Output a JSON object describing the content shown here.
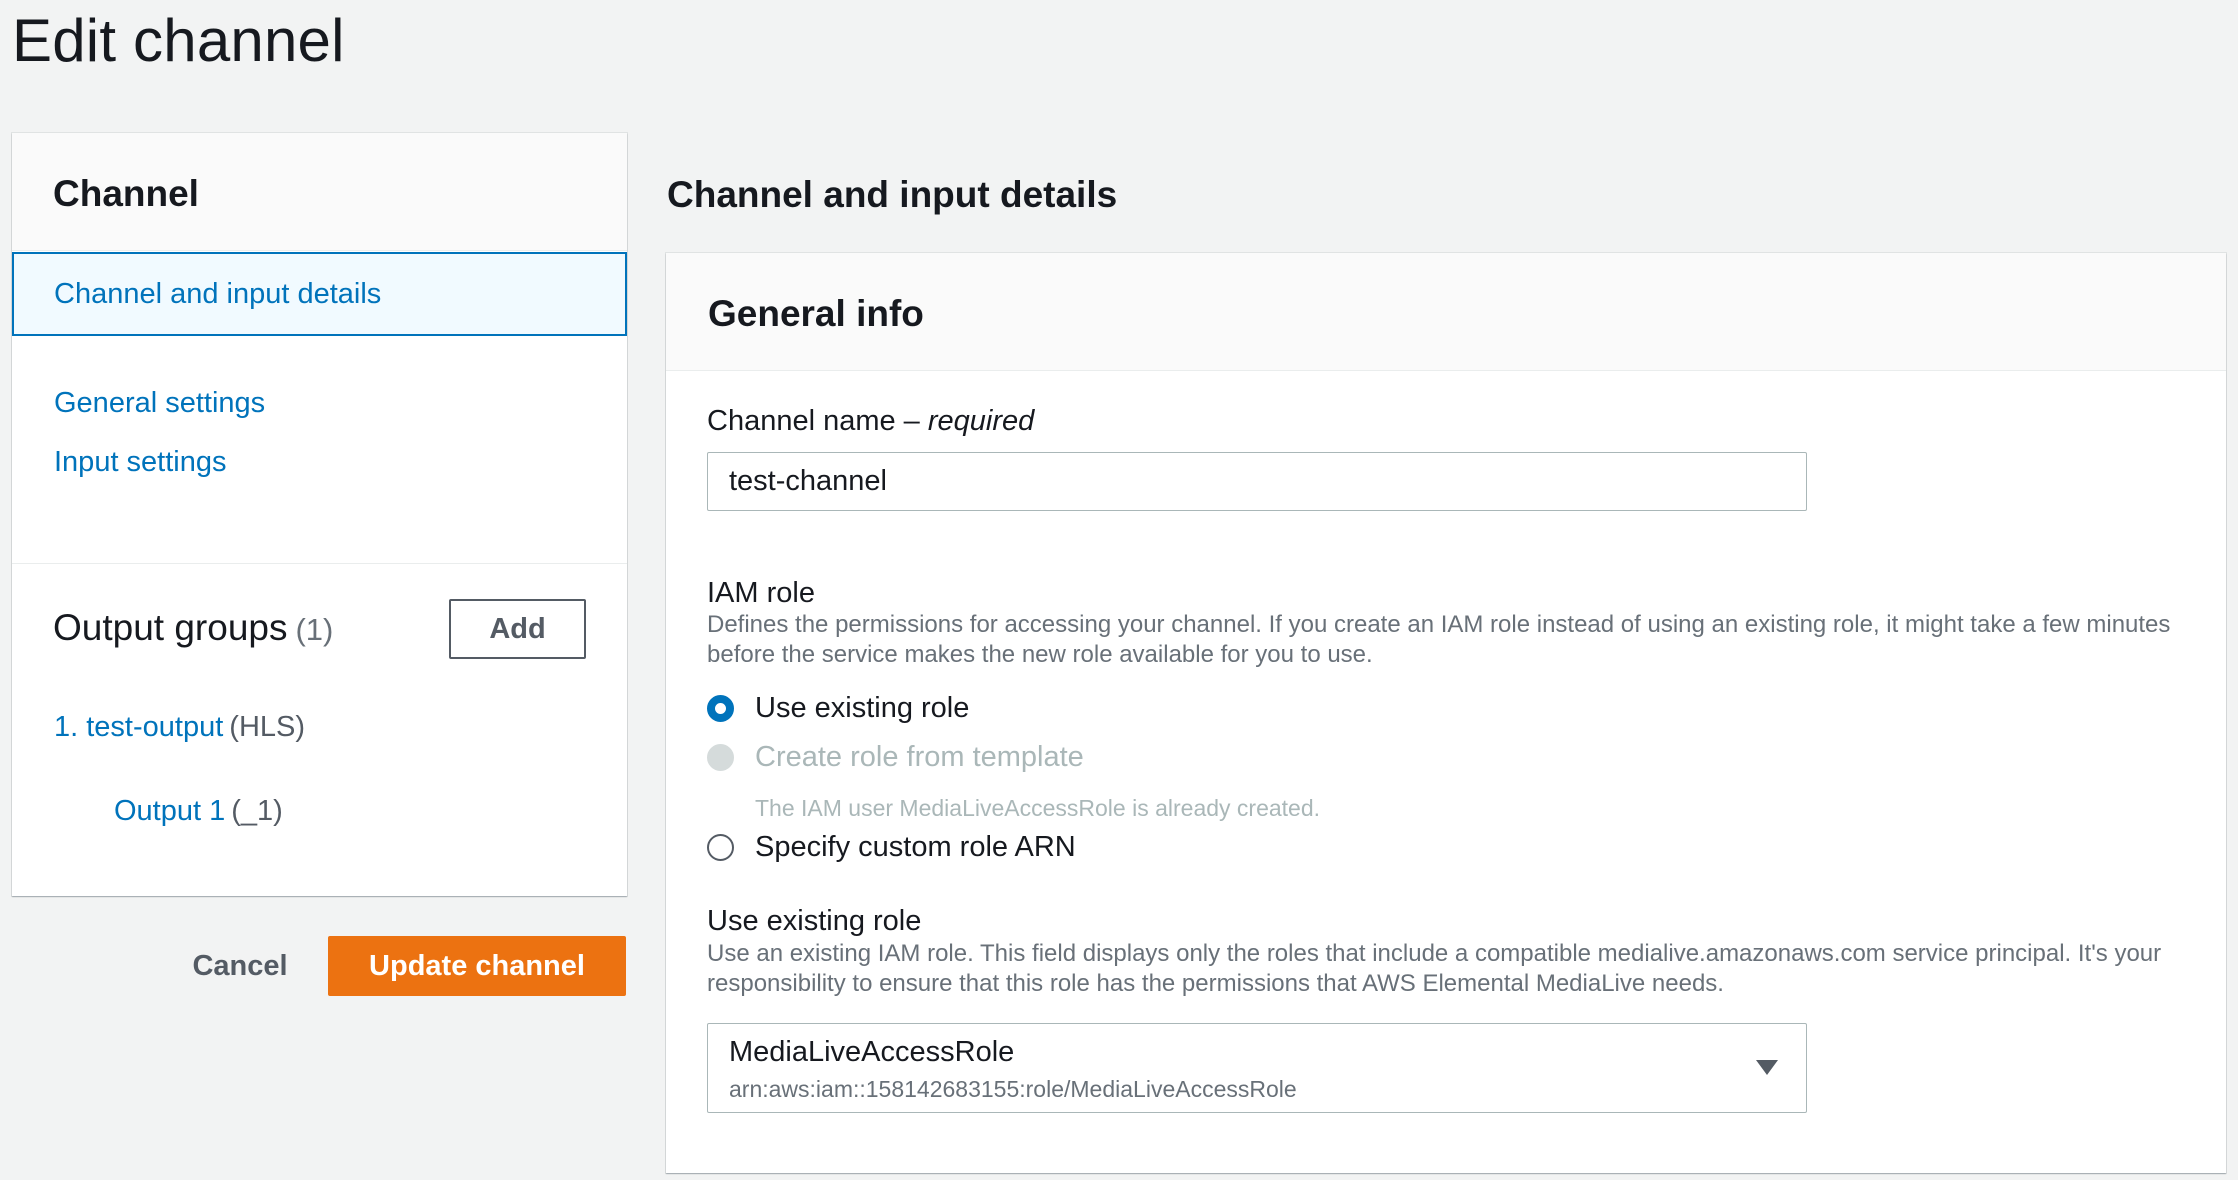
{
  "page": {
    "title": "Edit channel"
  },
  "nav": {
    "header": "Channel",
    "items": [
      {
        "label": "Channel and input details",
        "active": true
      },
      {
        "label": "General settings",
        "active": false
      },
      {
        "label": "Input settings",
        "active": false
      }
    ],
    "output_groups": {
      "title": "Output groups",
      "count": "(1)",
      "add_label": "Add",
      "group": {
        "label": "1. test-output",
        "type": "(HLS)"
      },
      "output": {
        "label": "Output 1",
        "suffix": "(_1)"
      }
    }
  },
  "actions": {
    "cancel_label": "Cancel",
    "update_label": "Update channel"
  },
  "main": {
    "section_title": "Channel and input details",
    "card_title": "General info",
    "channel_name": {
      "label": "Channel name – ",
      "required": "required",
      "value": "test-channel"
    },
    "iam_role": {
      "label": "IAM role",
      "description": "Defines the permissions for accessing your channel. If you create an IAM role instead of using an existing role, it might take a few minutes before the service makes the new role available for you to use.",
      "options": [
        {
          "label": "Use existing role",
          "state": "checked"
        },
        {
          "label": "Create role from template",
          "state": "disabled",
          "description": "The IAM user MediaLiveAccessRole is already created."
        },
        {
          "label": "Specify custom role ARN",
          "state": "unchecked"
        }
      ]
    },
    "existing_role": {
      "label": "Use existing role",
      "description": "Use an existing IAM role. This field displays only the roles that include a compatible medialive.amazonaws.com service principal. It's your responsibility to ensure that this role has the permissions that AWS Elemental MediaLive needs.",
      "selected": "MediaLiveAccessRole",
      "selected_arn": "arn:aws:iam::158142683155:role/MediaLiveAccessRole"
    }
  },
  "colors": {
    "accent": "#0073bb",
    "primary_button": "#ec7211",
    "background": "#f2f3f3"
  }
}
